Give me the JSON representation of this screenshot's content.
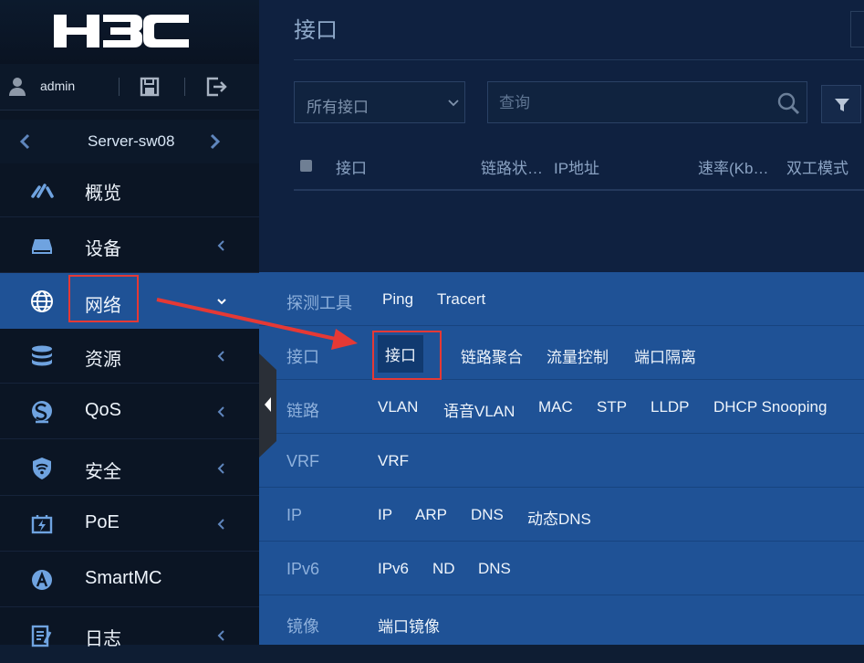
{
  "brand": {
    "logo_text": "H3C"
  },
  "user": {
    "name": "admin"
  },
  "device": {
    "name": "Server-sw08"
  },
  "nav": {
    "items": [
      {
        "label": "概览",
        "icon": "dashboard-icon",
        "has_chevron": false
      },
      {
        "label": "设备",
        "icon": "device-icon",
        "has_chevron": true
      },
      {
        "label": "网络",
        "icon": "globe-icon",
        "has_chevron": true,
        "active": true
      },
      {
        "label": "资源",
        "icon": "database-icon",
        "has_chevron": true
      },
      {
        "label": "QoS",
        "icon": "qos-icon",
        "has_chevron": true
      },
      {
        "label": "安全",
        "icon": "shield-wifi-icon",
        "has_chevron": true
      },
      {
        "label": "PoE",
        "icon": "poe-icon",
        "has_chevron": true
      },
      {
        "label": "SmartMC",
        "icon": "smartmc-icon",
        "has_chevron": false
      },
      {
        "label": "日志",
        "icon": "log-icon",
        "has_chevron": true
      }
    ]
  },
  "main": {
    "title": "接口",
    "filter_select": {
      "selected": "所有接口"
    },
    "search": {
      "placeholder": "查询"
    },
    "table": {
      "headers": [
        "接口",
        "链路状…",
        "IP地址",
        "速率(Kb…",
        "双工模式"
      ]
    }
  },
  "mega_menu": {
    "rows": [
      {
        "category": "探测工具",
        "links": [
          "Ping",
          "Tracert"
        ]
      },
      {
        "category": "接口",
        "links": [
          "接口",
          "链路聚合",
          "流量控制",
          "端口隔离"
        ],
        "selected_index": 0
      },
      {
        "category": "链路",
        "links": [
          "VLAN",
          "语音VLAN",
          "MAC",
          "STP",
          "LLDP",
          "DHCP Snooping"
        ]
      },
      {
        "category": "VRF",
        "links": [
          "VRF"
        ]
      },
      {
        "category": "IP",
        "links": [
          "IP",
          "ARP",
          "DNS",
          "动态DNS"
        ]
      },
      {
        "category": "IPv6",
        "links": [
          "IPv6",
          "ND",
          "DNS"
        ]
      },
      {
        "category": "镜像",
        "links": [
          "端口镜像"
        ]
      }
    ]
  },
  "colors": {
    "sidebar_bg": "#0b1524",
    "active_blue": "#1f5296",
    "highlight_red": "#e53935",
    "main_bg": "#0f2140"
  }
}
